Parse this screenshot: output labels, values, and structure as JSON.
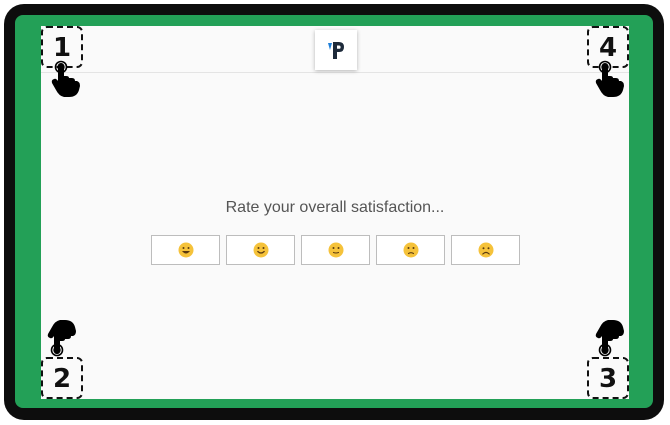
{
  "survey": {
    "question": "Rate your overall satisfaction...",
    "options": [
      {
        "icon": "very-satisfied-face-icon"
      },
      {
        "icon": "satisfied-face-icon"
      },
      {
        "icon": "neutral-face-icon"
      },
      {
        "icon": "dissatisfied-face-icon"
      },
      {
        "icon": "very-dissatisfied-face-icon"
      }
    ]
  },
  "logo": {
    "icon": "brand-p-logo"
  },
  "corners": {
    "top_left": "1",
    "bottom_left": "2",
    "bottom_right": "3",
    "top_right": "4"
  },
  "colors": {
    "device_frame": "#0d0d0d",
    "bezel": "#23a057",
    "screen": "#fafafa",
    "emoji_fill": "#f5c23a",
    "logo_dark": "#1d2a3a",
    "logo_accent": "#1f7fd8"
  }
}
